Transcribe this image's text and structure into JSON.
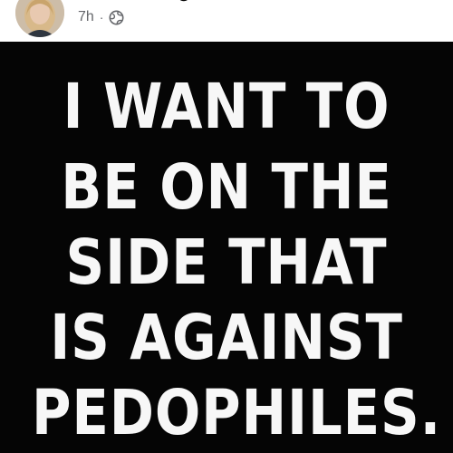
{
  "post": {
    "timestamp": "7h",
    "separator": "·",
    "privacy_icon": "globe-icon",
    "author_avatar": "avatar"
  },
  "image": {
    "lines": [
      "I WANT TO",
      "BE ON THE",
      "SIDE THAT",
      "IS AGAINST",
      "PEDOPHILES."
    ]
  },
  "colors": {
    "image_background": "#050505",
    "image_text": "#f7f7f7",
    "meta_text": "#65676b",
    "header_background": "#ffffff"
  }
}
